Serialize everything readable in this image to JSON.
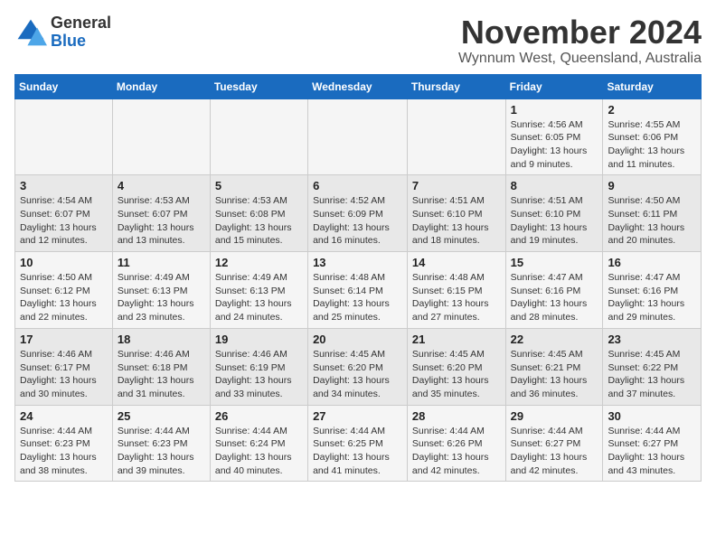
{
  "logo": {
    "general": "General",
    "blue": "Blue"
  },
  "title": "November 2024",
  "location": "Wynnum West, Queensland, Australia",
  "weekdays": [
    "Sunday",
    "Monday",
    "Tuesday",
    "Wednesday",
    "Thursday",
    "Friday",
    "Saturday"
  ],
  "weeks": [
    [
      {
        "day": "",
        "info": ""
      },
      {
        "day": "",
        "info": ""
      },
      {
        "day": "",
        "info": ""
      },
      {
        "day": "",
        "info": ""
      },
      {
        "day": "",
        "info": ""
      },
      {
        "day": "1",
        "info": "Sunrise: 4:56 AM\nSunset: 6:05 PM\nDaylight: 13 hours and 9 minutes."
      },
      {
        "day": "2",
        "info": "Sunrise: 4:55 AM\nSunset: 6:06 PM\nDaylight: 13 hours and 11 minutes."
      }
    ],
    [
      {
        "day": "3",
        "info": "Sunrise: 4:54 AM\nSunset: 6:07 PM\nDaylight: 13 hours and 12 minutes."
      },
      {
        "day": "4",
        "info": "Sunrise: 4:53 AM\nSunset: 6:07 PM\nDaylight: 13 hours and 13 minutes."
      },
      {
        "day": "5",
        "info": "Sunrise: 4:53 AM\nSunset: 6:08 PM\nDaylight: 13 hours and 15 minutes."
      },
      {
        "day": "6",
        "info": "Sunrise: 4:52 AM\nSunset: 6:09 PM\nDaylight: 13 hours and 16 minutes."
      },
      {
        "day": "7",
        "info": "Sunrise: 4:51 AM\nSunset: 6:10 PM\nDaylight: 13 hours and 18 minutes."
      },
      {
        "day": "8",
        "info": "Sunrise: 4:51 AM\nSunset: 6:10 PM\nDaylight: 13 hours and 19 minutes."
      },
      {
        "day": "9",
        "info": "Sunrise: 4:50 AM\nSunset: 6:11 PM\nDaylight: 13 hours and 20 minutes."
      }
    ],
    [
      {
        "day": "10",
        "info": "Sunrise: 4:50 AM\nSunset: 6:12 PM\nDaylight: 13 hours and 22 minutes."
      },
      {
        "day": "11",
        "info": "Sunrise: 4:49 AM\nSunset: 6:13 PM\nDaylight: 13 hours and 23 minutes."
      },
      {
        "day": "12",
        "info": "Sunrise: 4:49 AM\nSunset: 6:13 PM\nDaylight: 13 hours and 24 minutes."
      },
      {
        "day": "13",
        "info": "Sunrise: 4:48 AM\nSunset: 6:14 PM\nDaylight: 13 hours and 25 minutes."
      },
      {
        "day": "14",
        "info": "Sunrise: 4:48 AM\nSunset: 6:15 PM\nDaylight: 13 hours and 27 minutes."
      },
      {
        "day": "15",
        "info": "Sunrise: 4:47 AM\nSunset: 6:16 PM\nDaylight: 13 hours and 28 minutes."
      },
      {
        "day": "16",
        "info": "Sunrise: 4:47 AM\nSunset: 6:16 PM\nDaylight: 13 hours and 29 minutes."
      }
    ],
    [
      {
        "day": "17",
        "info": "Sunrise: 4:46 AM\nSunset: 6:17 PM\nDaylight: 13 hours and 30 minutes."
      },
      {
        "day": "18",
        "info": "Sunrise: 4:46 AM\nSunset: 6:18 PM\nDaylight: 13 hours and 31 minutes."
      },
      {
        "day": "19",
        "info": "Sunrise: 4:46 AM\nSunset: 6:19 PM\nDaylight: 13 hours and 33 minutes."
      },
      {
        "day": "20",
        "info": "Sunrise: 4:45 AM\nSunset: 6:20 PM\nDaylight: 13 hours and 34 minutes."
      },
      {
        "day": "21",
        "info": "Sunrise: 4:45 AM\nSunset: 6:20 PM\nDaylight: 13 hours and 35 minutes."
      },
      {
        "day": "22",
        "info": "Sunrise: 4:45 AM\nSunset: 6:21 PM\nDaylight: 13 hours and 36 minutes."
      },
      {
        "day": "23",
        "info": "Sunrise: 4:45 AM\nSunset: 6:22 PM\nDaylight: 13 hours and 37 minutes."
      }
    ],
    [
      {
        "day": "24",
        "info": "Sunrise: 4:44 AM\nSunset: 6:23 PM\nDaylight: 13 hours and 38 minutes."
      },
      {
        "day": "25",
        "info": "Sunrise: 4:44 AM\nSunset: 6:23 PM\nDaylight: 13 hours and 39 minutes."
      },
      {
        "day": "26",
        "info": "Sunrise: 4:44 AM\nSunset: 6:24 PM\nDaylight: 13 hours and 40 minutes."
      },
      {
        "day": "27",
        "info": "Sunrise: 4:44 AM\nSunset: 6:25 PM\nDaylight: 13 hours and 41 minutes."
      },
      {
        "day": "28",
        "info": "Sunrise: 4:44 AM\nSunset: 6:26 PM\nDaylight: 13 hours and 42 minutes."
      },
      {
        "day": "29",
        "info": "Sunrise: 4:44 AM\nSunset: 6:27 PM\nDaylight: 13 hours and 42 minutes."
      },
      {
        "day": "30",
        "info": "Sunrise: 4:44 AM\nSunset: 6:27 PM\nDaylight: 13 hours and 43 minutes."
      }
    ]
  ]
}
